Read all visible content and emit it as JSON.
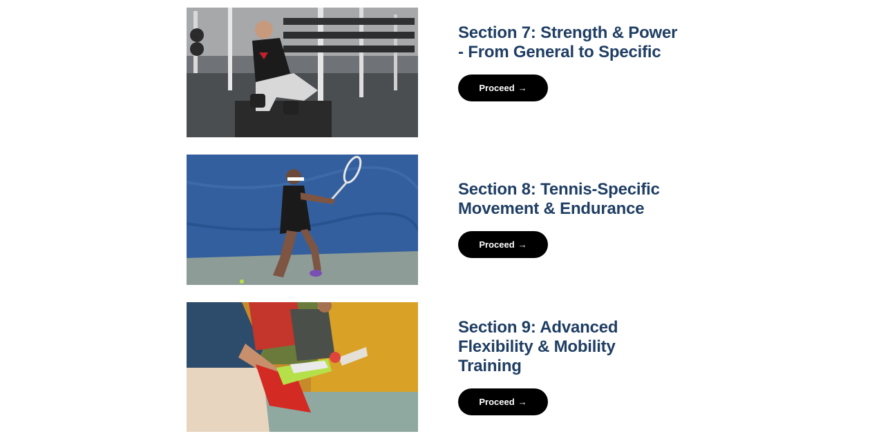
{
  "sections": [
    {
      "title": "Section 7: Strength & Power - From General to Specific",
      "button_label": "Proceed",
      "button_icon": "→",
      "image_icon": "gym-lunge-photo"
    },
    {
      "title": "Section 8: Tennis-Specific Movement & Endurance",
      "button_label": "Proceed",
      "button_icon": "→",
      "image_icon": "tennis-player-photo"
    },
    {
      "title": "Section 9: Advanced Flexibility & Mobility Training",
      "button_label": "Proceed",
      "button_icon": "→",
      "image_icon": "stretching-group-photo"
    }
  ],
  "colors": {
    "title": "#1f3e63",
    "button_bg": "#000000",
    "button_text": "#ffffff",
    "background": "#ffffff"
  }
}
